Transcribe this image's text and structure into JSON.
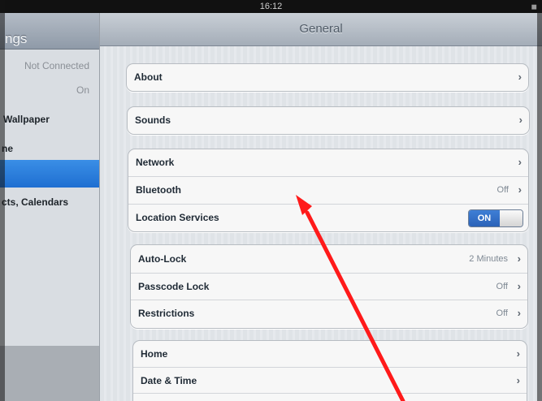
{
  "status_bar": {
    "time": "16:12",
    "battery": "◼"
  },
  "master": {
    "title": "ngs",
    "items": [
      {
        "label": "",
        "value": "Not Connected"
      },
      {
        "label": "",
        "value": "On"
      },
      {
        "label": "Wallpaper",
        "value": ""
      },
      {
        "label": "ne",
        "value": ""
      },
      {
        "label": "",
        "value": ""
      },
      {
        "label": "cts, Calendars",
        "value": ""
      }
    ]
  },
  "detail": {
    "title": "General",
    "groups": [
      {
        "rows": [
          {
            "label": "About",
            "value": "",
            "chevron": "›"
          }
        ]
      },
      {
        "rows": [
          {
            "label": "Sounds",
            "value": "",
            "chevron": "›"
          }
        ]
      },
      {
        "rows": [
          {
            "label": "Network",
            "value": "",
            "chevron": "›"
          },
          {
            "label": "Bluetooth",
            "value": "Off",
            "chevron": "›"
          },
          {
            "label": "Location Services",
            "value": "",
            "toggle": "ON"
          }
        ]
      },
      {
        "rows": [
          {
            "label": "Auto-Lock",
            "value": "2 Minutes",
            "chevron": "›"
          },
          {
            "label": "Passcode Lock",
            "value": "Off",
            "chevron": "›"
          },
          {
            "label": "Restrictions",
            "value": "Off",
            "chevron": "›"
          }
        ]
      },
      {
        "rows": [
          {
            "label": "Home",
            "value": "",
            "chevron": "›"
          },
          {
            "label": "Date & Time",
            "value": "",
            "chevron": "›"
          }
        ]
      }
    ]
  },
  "colors": {
    "selection_blue": "#2a7ad9",
    "toggle_on_blue": "#3572c9",
    "annotation_red": "#ff1a1a"
  }
}
